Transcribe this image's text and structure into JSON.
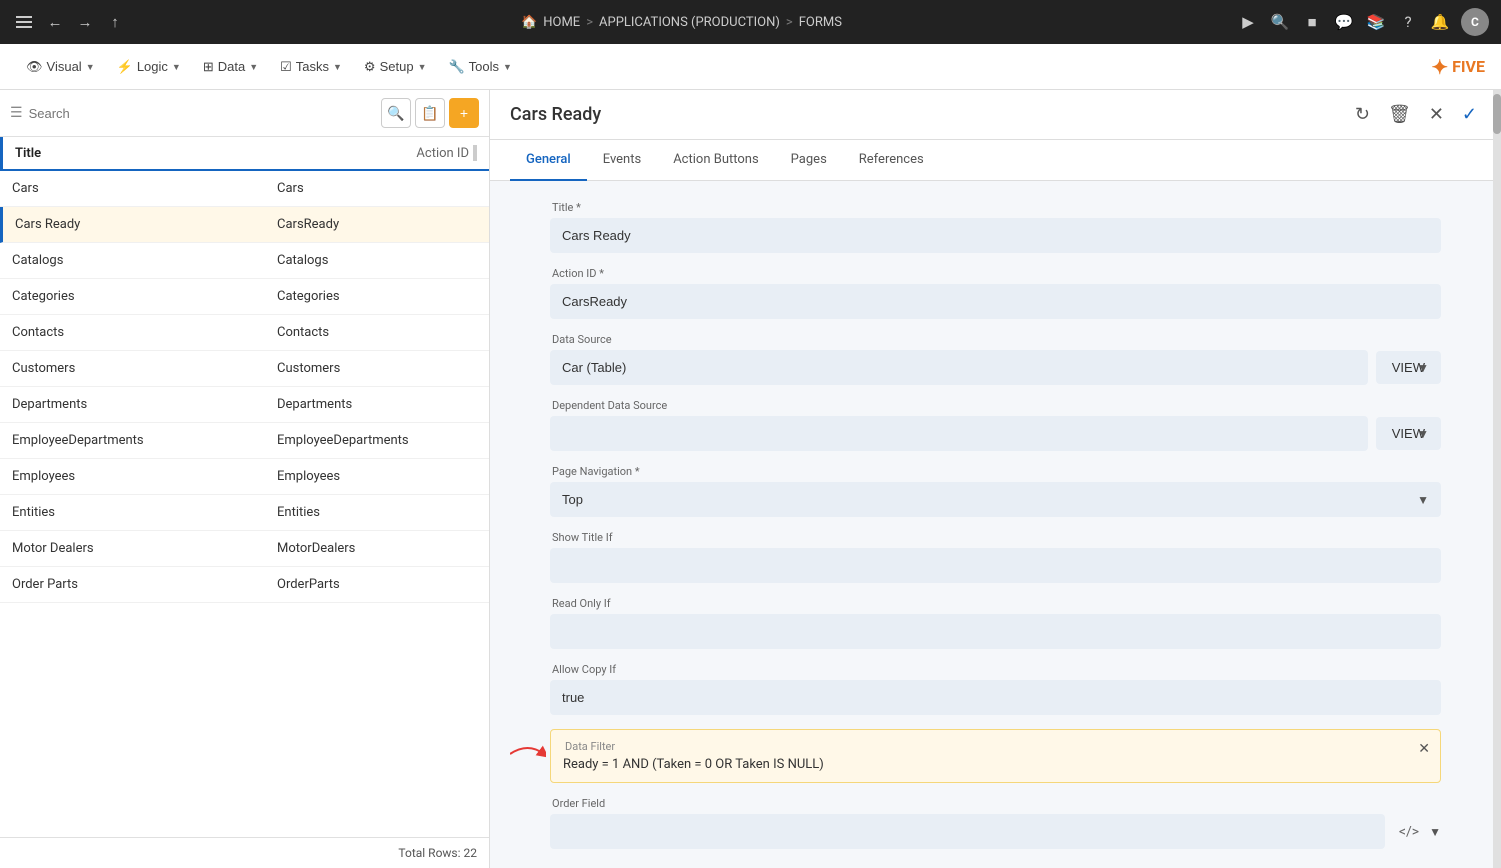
{
  "topNav": {
    "homeLabel": "HOME",
    "applicationsLabel": "APPLICATIONS (PRODUCTION)",
    "formsLabel": "FORMS",
    "sep": ">",
    "avatarLabel": "C"
  },
  "secondaryToolbar": {
    "visual": "Visual",
    "logic": "Logic",
    "data": "Data",
    "tasks": "Tasks",
    "setup": "Setup",
    "tools": "Tools",
    "logo": "FIVE"
  },
  "sidebar": {
    "searchPlaceholder": "Search",
    "columns": {
      "title": "Title",
      "actionId": "Action ID"
    },
    "rows": [
      {
        "title": "Cars",
        "actionId": "Cars"
      },
      {
        "title": "Cars Ready",
        "actionId": "CarsReady",
        "selected": true
      },
      {
        "title": "Catalogs",
        "actionId": "Catalogs"
      },
      {
        "title": "Categories",
        "actionId": "Categories"
      },
      {
        "title": "Contacts",
        "actionId": "Contacts"
      },
      {
        "title": "Customers",
        "actionId": "Customers"
      },
      {
        "title": "Departments",
        "actionId": "Departments"
      },
      {
        "title": "EmployeeDepartments",
        "actionId": "EmployeeDepartments"
      },
      {
        "title": "Employees",
        "actionId": "Employees"
      },
      {
        "title": "Entities",
        "actionId": "Entities"
      },
      {
        "title": "Motor Dealers",
        "actionId": "MotorDealers"
      },
      {
        "title": "Order Parts",
        "actionId": "OrderParts"
      }
    ],
    "footer": "Total Rows: 22"
  },
  "rightPanel": {
    "title": "Cars Ready",
    "tabs": [
      {
        "label": "General",
        "active": true
      },
      {
        "label": "Events",
        "active": false
      },
      {
        "label": "Action Buttons",
        "active": false
      },
      {
        "label": "Pages",
        "active": false
      },
      {
        "label": "References",
        "active": false
      }
    ],
    "form": {
      "titleLabel": "Title *",
      "titleValue": "Cars Ready",
      "actionIdLabel": "Action ID *",
      "actionIdValue": "CarsReady",
      "dataSourceLabel": "Data Source",
      "dataSourceValue": "Car (Table)",
      "viewLabel": "VIEW",
      "dependentDataSourceLabel": "Dependent Data Source",
      "dependentViewLabel": "VIEW",
      "pageNavigationLabel": "Page Navigation *",
      "pageNavigationValue": "Top",
      "showTitleIfLabel": "Show Title If",
      "showTitleIfValue": "",
      "readOnlyIfLabel": "Read Only If",
      "readOnlyIfValue": "",
      "allowCopyIfLabel": "Allow Copy If",
      "allowCopyIfValue": "true",
      "dataFilterLabel": "Data Filter",
      "dataFilterValue": "Ready = 1 AND (Taken = 0 OR Taken IS NULL)",
      "orderFieldLabel": "Order Field"
    }
  }
}
